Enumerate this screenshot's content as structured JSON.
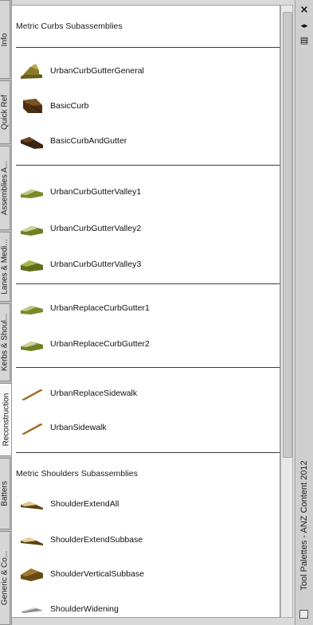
{
  "tabs": [
    {
      "label": "Info"
    },
    {
      "label": "Quick Ref"
    },
    {
      "label": "Assemblies A..."
    },
    {
      "label": "Lanes & Medi..."
    },
    {
      "label": "Kerbs & Shoul..."
    },
    {
      "label": "Reconstruction"
    },
    {
      "label": "Batters"
    },
    {
      "label": "Generic & Co..."
    }
  ],
  "palette_title": "Tool Palettes - ANZ Content 2012",
  "sections": {
    "curbs_title": "Metric Curbs Subassemblies",
    "shoulders_title": "Metric Shoulders Subassemblies"
  },
  "tools": [
    {
      "label": "UrbanCurbGutterGeneral",
      "icon": "curb-gutter-general-icon"
    },
    {
      "label": "BasicCurb",
      "icon": "basic-curb-icon"
    },
    {
      "label": "BasicCurbAndGutter",
      "icon": "basic-curb-gutter-icon"
    },
    {
      "label": "UrbanCurbGutterValley1",
      "icon": "curb-gutter-valley-icon"
    },
    {
      "label": "UrbanCurbGutterValley2",
      "icon": "curb-gutter-valley-icon"
    },
    {
      "label": "UrbanCurbGutterValley3",
      "icon": "curb-gutter-valley-icon"
    },
    {
      "label": "UrbanReplaceCurbGutter1",
      "icon": "replace-curb-gutter-icon"
    },
    {
      "label": "UrbanReplaceCurbGutter2",
      "icon": "replace-curb-gutter-icon"
    },
    {
      "label": "UrbanReplaceSidewalk",
      "icon": "sidewalk-icon"
    },
    {
      "label": "UrbanSidewalk",
      "icon": "sidewalk-icon"
    },
    {
      "label": "ShoulderExtendAll",
      "icon": "shoulder-icon"
    },
    {
      "label": "ShoulderExtendSubbase",
      "icon": "shoulder-icon"
    },
    {
      "label": "ShoulderVerticalSubbase",
      "icon": "shoulder-vertical-icon"
    },
    {
      "label": "ShoulderWidening",
      "icon": "shoulder-widening-icon"
    }
  ],
  "titlebar_buttons": {
    "close": "×",
    "autohide": "◂▸",
    "properties": "▤"
  }
}
